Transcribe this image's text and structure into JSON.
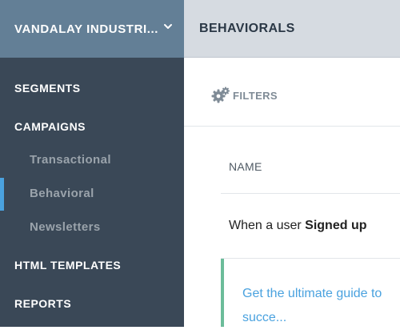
{
  "sidebar": {
    "org_name": "VANDALAY INDUSTRI...",
    "nav": [
      {
        "label": "SEGMENTS"
      },
      {
        "label": "CAMPAIGNS"
      },
      {
        "label": "HTML TEMPLATES"
      },
      {
        "label": "REPORTS"
      }
    ],
    "campaign_items": [
      {
        "label": "Transactional"
      },
      {
        "label": "Behavioral",
        "active": true
      },
      {
        "label": "Newsletters"
      }
    ]
  },
  "header": {
    "title": "BEHAVIORALS"
  },
  "toolbar": {
    "filters_label": "FILTERS"
  },
  "table": {
    "column_name": "NAME",
    "rows": [
      {
        "prefix": "When a user ",
        "event": "Signed up"
      }
    ]
  },
  "card": {
    "link_text": "Get the ultimate guide to succe..."
  },
  "colors": {
    "sidebar_bg": "#3a4857",
    "org_bg": "#637f96",
    "header_bg": "#d6dbe1",
    "accent_blue": "#4aa2df",
    "accent_green": "#6cbc9a"
  }
}
